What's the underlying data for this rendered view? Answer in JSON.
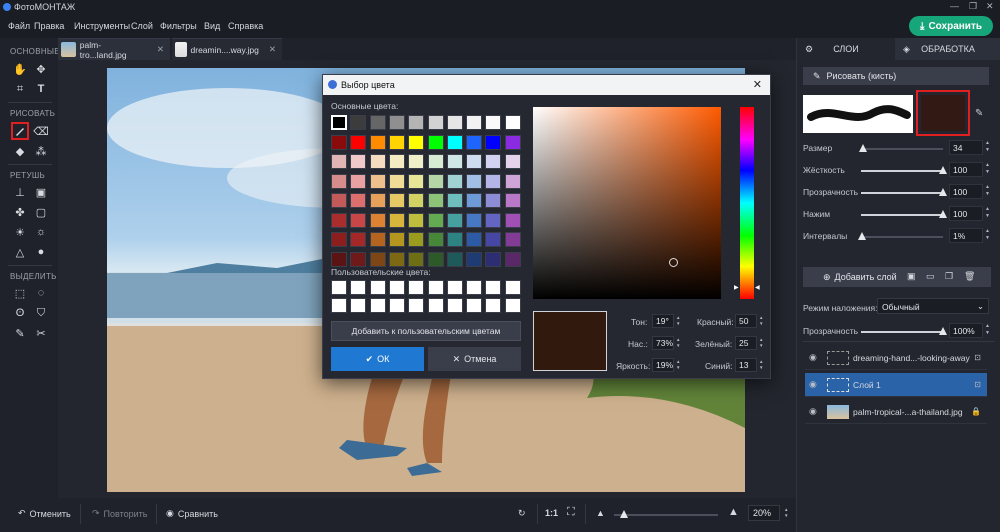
{
  "app": {
    "title": "ФотоМОНТАЖ",
    "save_label": "Сохранить",
    "menu": [
      "Файл",
      "Правка",
      "Инструменты",
      "Слой",
      "Фильтры",
      "Вид",
      "Справка"
    ]
  },
  "toolbar": {
    "sections": [
      "ОСНОВНЫЕ",
      "РИСОВАТЬ",
      "РЕТУШЬ",
      "ВЫДЕЛИТЬ"
    ]
  },
  "tabs": [
    {
      "label": "palm-tro...land.jpg"
    },
    {
      "label": "dreamin....way.jpg"
    }
  ],
  "bottom": {
    "undo_label": "Отменить",
    "redo_label": "Повторить",
    "compare_label": "Сравнить",
    "ratio_label": "1:1",
    "zoom_value": "20%",
    "zoom_level": 0.1
  },
  "right_panel": {
    "tabs": [
      "СЛОИ",
      "ОБРАБОТКА"
    ],
    "brush_button": "Рисовать (кисть)",
    "brush_color": "#321913",
    "sliders": [
      {
        "label": "Размер",
        "value": "34",
        "level": 0.02
      },
      {
        "label": "Жёсткость",
        "value": "100",
        "level": 1
      },
      {
        "label": "Прозрачность",
        "value": "100",
        "level": 1
      },
      {
        "label": "Нажим",
        "value": "100",
        "level": 1
      },
      {
        "label": "Интервалы",
        "value": "1%",
        "level": 0.01
      }
    ],
    "add_layer_label": "Добавить слой",
    "blend_mode_label": "Режим наложения:",
    "blend_mode_value": "Обычный",
    "opacity_label": "Прозрачность",
    "opacity_value": "100%",
    "layers": [
      {
        "name": "dreaming-hand...-looking-away",
        "selected": false
      },
      {
        "name": "Слой 1",
        "selected": true
      },
      {
        "name": "palm-tropical-...a-thailand.jpg",
        "selected": false
      }
    ]
  },
  "color_dialog": {
    "title": "Выбор цвета",
    "basic_label": "Основные цвета:",
    "custom_label": "Пользовательские цвета:",
    "add_custom_label": "Добавить к пользовательским цветам",
    "ok_label": "ОК",
    "cancel_label": "Отмена",
    "hue_label": "Тон:",
    "hue_value": "19°",
    "sat_label": "Нас.:",
    "sat_value": "73%",
    "val_label": "Яркость:",
    "val_value": "19%",
    "red_label": "Красный:",
    "red_value": "50",
    "green_label": "Зелёный:",
    "green_value": "25",
    "blue_label": "Синий:",
    "blue_value": "13",
    "current_color": "#32190d",
    "basic_colors": [
      [
        "#000000",
        "#3c3c3c",
        "#666666",
        "#8f8f8f",
        "#b4b4b4",
        "#d2d2d2",
        "#e6e6e6",
        "#f2f2f2",
        "#fafafa",
        "#ffffff"
      ],
      [
        "#8a0b0b",
        "#ff0000",
        "#ff8c00",
        "#ffd400",
        "#ffff00",
        "#00ff00",
        "#00ffff",
        "#1e64ff",
        "#0000ff",
        "#8a2be2"
      ],
      [
        "#e0b4b4",
        "#f0c8c8",
        "#f5dcc0",
        "#f5ebc3",
        "#f0f0c8",
        "#d7ebd2",
        "#cfe6e6",
        "#cfdcf0",
        "#d2d2f0",
        "#e4d2ea"
      ],
      [
        "#d78c8c",
        "#e8a0a0",
        "#eec08c",
        "#f0dc96",
        "#e6e696",
        "#b4d7a5",
        "#a0d2d2",
        "#a0bee6",
        "#b4b4e6",
        "#cfa5d7"
      ],
      [
        "#c35a5a",
        "#dc6e6e",
        "#e6a05a",
        "#e6c864",
        "#d2d264",
        "#8cc378",
        "#6ebebe",
        "#6e9bd7",
        "#8c8cd7",
        "#b978c8"
      ],
      [
        "#aa2d2d",
        "#c84646",
        "#dc8232",
        "#d7b43c",
        "#bebe3c",
        "#64aa50",
        "#46a0a0",
        "#4678c3",
        "#6464c3",
        "#a050b4"
      ],
      [
        "#8c1e1e",
        "#a52828",
        "#b4641e",
        "#b4961e",
        "#9b9b1e",
        "#46873a",
        "#2d8282",
        "#2d5aa5",
        "#4646a5",
        "#823c96"
      ],
      [
        "#5a1414",
        "#6e1a1a",
        "#7d4614",
        "#7d6914",
        "#6e6e14",
        "#2d5a28",
        "#1e5a5a",
        "#1e3c73",
        "#2d2d73",
        "#5a2869"
      ]
    ]
  }
}
